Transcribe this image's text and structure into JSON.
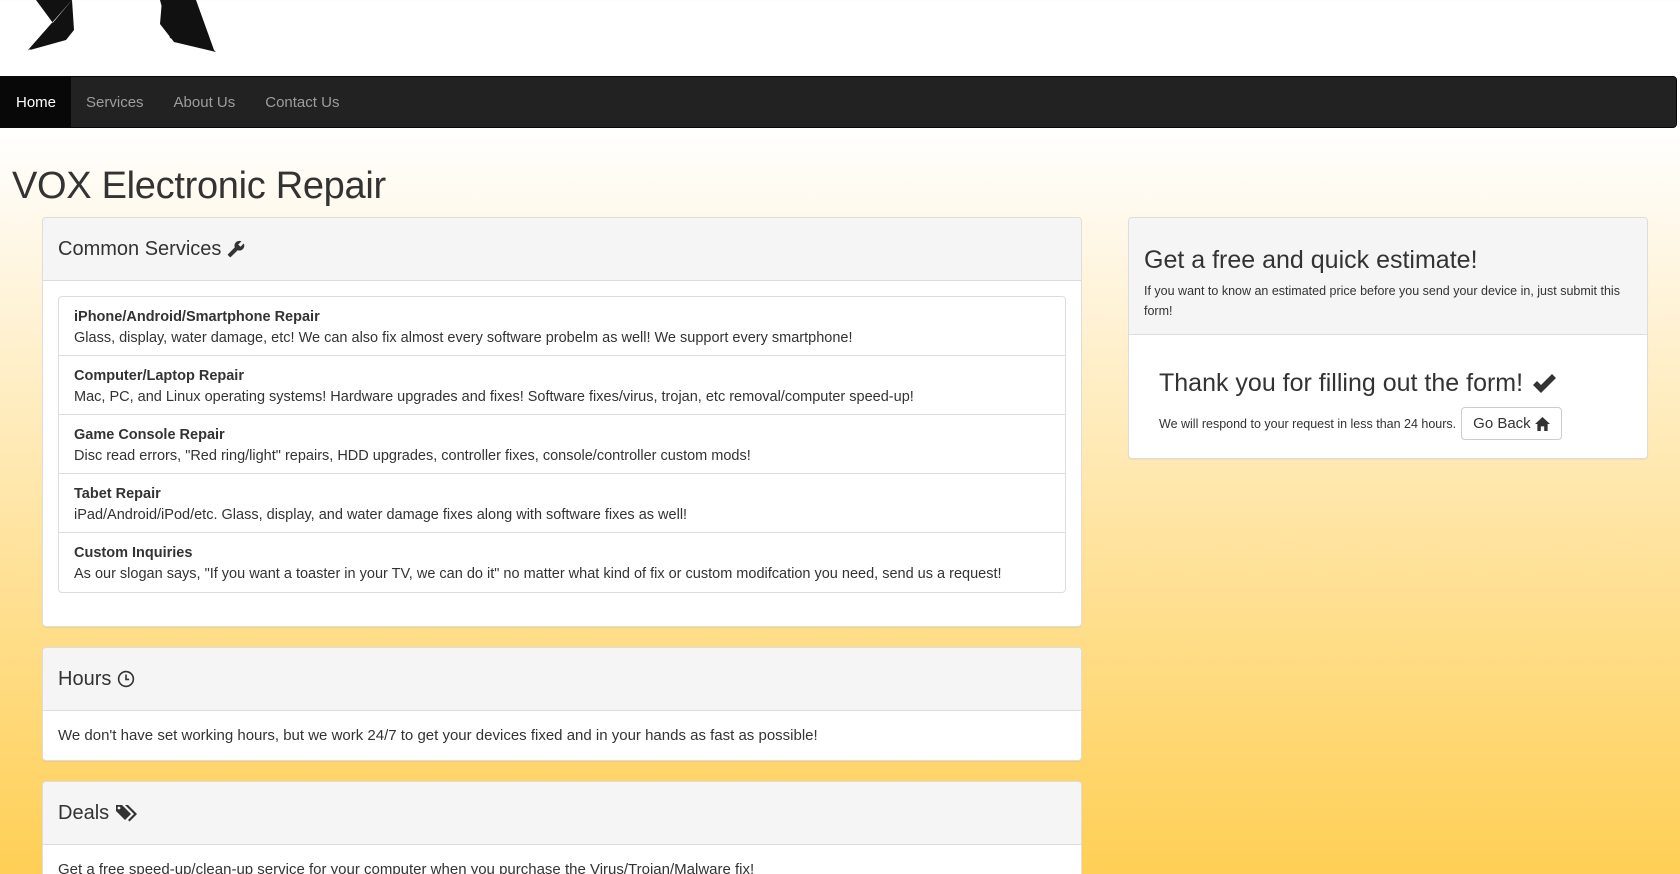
{
  "nav": {
    "items": [
      {
        "label": "Home",
        "active": true
      },
      {
        "label": "Services",
        "active": false
      },
      {
        "label": "About Us",
        "active": false
      },
      {
        "label": "Contact Us",
        "active": false
      }
    ]
  },
  "page_title": "VOX Electronic Repair",
  "services_panel": {
    "title": "Common Services",
    "icon": "wrench-icon",
    "items": [
      {
        "title": "iPhone/Android/Smartphone Repair",
        "text": "Glass, display, water damage, etc! We can also fix almost every software probelm as well! We support every smartphone!"
      },
      {
        "title": "Computer/Laptop Repair",
        "text": "Mac, PC, and Linux operating systems! Hardware upgrades and fixes! Software fixes/virus, trojan, etc removal/computer speed-up!"
      },
      {
        "title": "Game Console Repair",
        "text": "Disc read errors, \"Red ring/light\" repairs, HDD upgrades, controller fixes, console/controller custom mods!"
      },
      {
        "title": "Tabet Repair",
        "text": "iPad/Android/iPod/etc. Glass, display, and water damage fixes along with software fixes as well!"
      },
      {
        "title": "Custom Inquiries",
        "text": "As our slogan says, \"If you want a toaster in your TV, we can do it\" no matter what kind of fix or custom modifcation you need, send us a request!"
      }
    ]
  },
  "hours_panel": {
    "title": "Hours",
    "icon": "clock-icon",
    "text": "We don't have set working hours, but we work 24/7 to get your devices fixed and in your hands as fast as possible!"
  },
  "deals_panel": {
    "title": "Deals",
    "icon": "tags-icon",
    "text": "Get a free speed-up/clean-up service for your computer when you purchase the Virus/Trojan/Malware fix!"
  },
  "estimate_panel": {
    "title": "Get a free and quick estimate!",
    "subtitle": "If you want to know an estimated price before you send your device in, just submit this form!",
    "thanks_title": "Thank you for filling out the form!",
    "thanks_icon": "checkmark-icon",
    "thanks_text": "We will respond to your request in less than 24 hours.",
    "back_button": "Go Back",
    "back_icon": "home-icon"
  },
  "colors": {
    "navbar_bg": "#222222",
    "nav_active_bg": "#080808",
    "gradient_bottom": "#ffcf55"
  }
}
